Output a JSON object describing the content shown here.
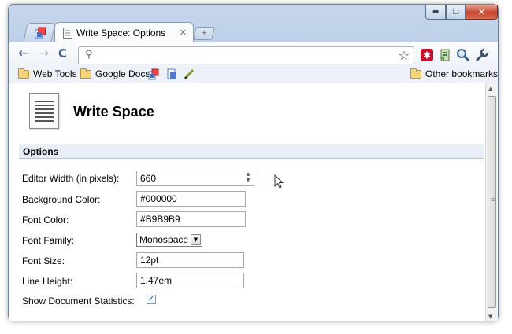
{
  "window": {
    "controls": {
      "minimize": "▬",
      "maximize": "□",
      "close": "✕"
    }
  },
  "tabs": [
    {
      "title": "Write Space: Options",
      "close_glyph": "✕"
    }
  ],
  "new_tab_glyph": "+",
  "toolbar": {
    "back_icon": "←",
    "forward_icon": "→",
    "reload_icon": "C",
    "search_icon": "⚲",
    "star_icon": "☆",
    "url_value": ""
  },
  "bookmarks": {
    "items": [
      {
        "label": "Web Tools",
        "icon": "folder-icon"
      },
      {
        "label": "Google Docs",
        "icon": "folder-icon"
      }
    ],
    "other": "Other bookmarks"
  },
  "page": {
    "app_title": "Write Space",
    "section_title": "Options",
    "options": [
      {
        "label": "Editor Width (in pixels):",
        "value": "660"
      },
      {
        "label": "Background Color:",
        "value": "#000000"
      },
      {
        "label": "Font Color:",
        "value": "#B9B9B9"
      },
      {
        "label": "Font Family:",
        "value": "Monospace"
      },
      {
        "label": "Font Size:",
        "value": "12pt"
      },
      {
        "label": "Line Height:",
        "value": "1.47em"
      },
      {
        "label": "Show Document Statistics:",
        "checked": true,
        "check_glyph": "✓"
      }
    ]
  },
  "scrollbar": {
    "up": "▲",
    "down": "▼",
    "grip": "≡"
  },
  "colors": {
    "chrome_frame": "#b7cbe4",
    "section_bg": "#e8eef8",
    "close_red": "#c7462f"
  }
}
